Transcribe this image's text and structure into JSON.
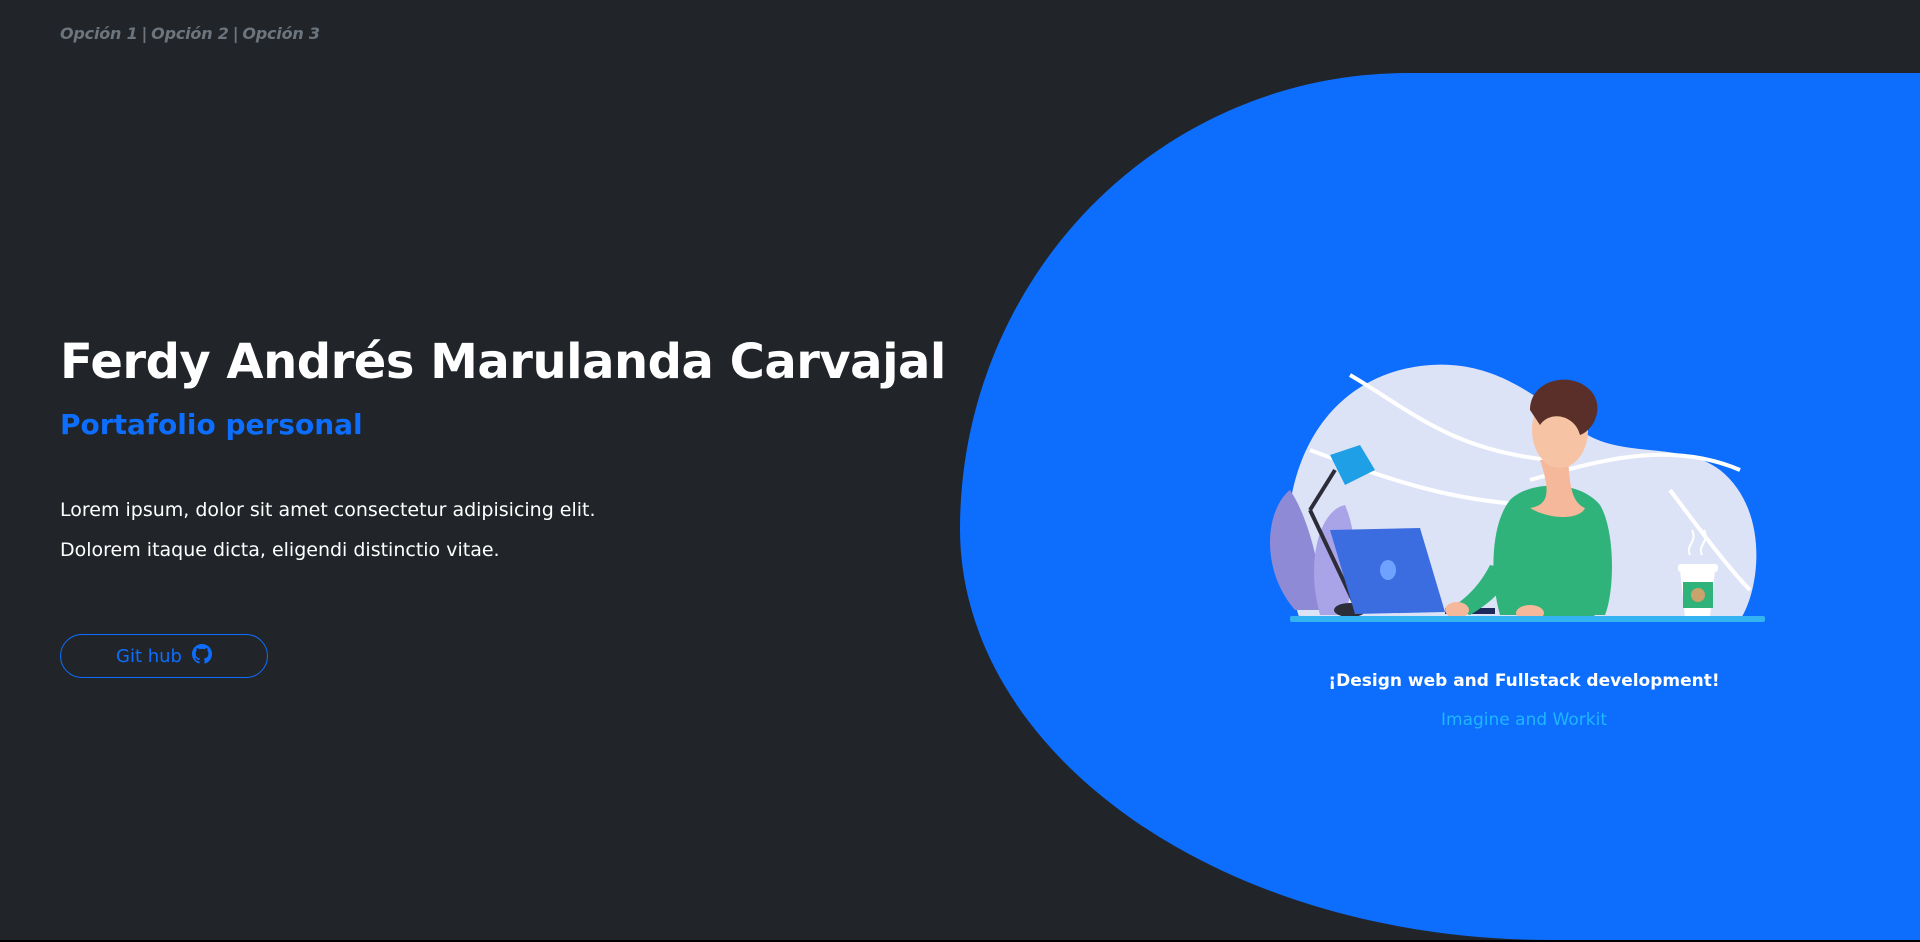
{
  "nav": {
    "items": [
      "Opción 1",
      "Opción 2",
      "Opción 3"
    ],
    "separator": "|"
  },
  "hero": {
    "title": "Ferdy Andrés Marulanda Carvajal",
    "subtitle": "Portafolio personal",
    "description": "Lorem ipsum, dolor sit amet consectetur adipisicing elit. Dolorem itaque dicta, eligendi distinctio vitae.",
    "button_label": "Git hub",
    "button_icon": "github-icon"
  },
  "illustration": {
    "caption_title": "¡Design web and Fullstack development!",
    "caption_subtitle": "Imagine and Workit",
    "icon": "developer-at-desk-illustration"
  },
  "colors": {
    "background": "#212529",
    "accent": "#0d6efd",
    "nav_text": "#6c757d",
    "caption_sub": "#1fb6ff"
  }
}
